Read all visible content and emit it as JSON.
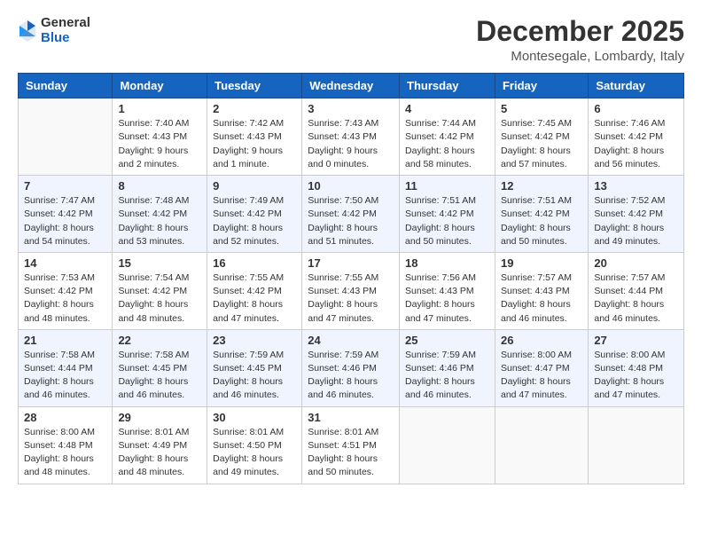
{
  "header": {
    "logo_general": "General",
    "logo_blue": "Blue",
    "month_title": "December 2025",
    "location": "Montesegale, Lombardy, Italy"
  },
  "days_of_week": [
    "Sunday",
    "Monday",
    "Tuesday",
    "Wednesday",
    "Thursday",
    "Friday",
    "Saturday"
  ],
  "weeks": [
    [
      {
        "day": "",
        "info": ""
      },
      {
        "day": "1",
        "info": "Sunrise: 7:40 AM\nSunset: 4:43 PM\nDaylight: 9 hours\nand 2 minutes."
      },
      {
        "day": "2",
        "info": "Sunrise: 7:42 AM\nSunset: 4:43 PM\nDaylight: 9 hours\nand 1 minute."
      },
      {
        "day": "3",
        "info": "Sunrise: 7:43 AM\nSunset: 4:43 PM\nDaylight: 9 hours\nand 0 minutes."
      },
      {
        "day": "4",
        "info": "Sunrise: 7:44 AM\nSunset: 4:42 PM\nDaylight: 8 hours\nand 58 minutes."
      },
      {
        "day": "5",
        "info": "Sunrise: 7:45 AM\nSunset: 4:42 PM\nDaylight: 8 hours\nand 57 minutes."
      },
      {
        "day": "6",
        "info": "Sunrise: 7:46 AM\nSunset: 4:42 PM\nDaylight: 8 hours\nand 56 minutes."
      }
    ],
    [
      {
        "day": "7",
        "info": "Sunrise: 7:47 AM\nSunset: 4:42 PM\nDaylight: 8 hours\nand 54 minutes."
      },
      {
        "day": "8",
        "info": "Sunrise: 7:48 AM\nSunset: 4:42 PM\nDaylight: 8 hours\nand 53 minutes."
      },
      {
        "day": "9",
        "info": "Sunrise: 7:49 AM\nSunset: 4:42 PM\nDaylight: 8 hours\nand 52 minutes."
      },
      {
        "day": "10",
        "info": "Sunrise: 7:50 AM\nSunset: 4:42 PM\nDaylight: 8 hours\nand 51 minutes."
      },
      {
        "day": "11",
        "info": "Sunrise: 7:51 AM\nSunset: 4:42 PM\nDaylight: 8 hours\nand 50 minutes."
      },
      {
        "day": "12",
        "info": "Sunrise: 7:51 AM\nSunset: 4:42 PM\nDaylight: 8 hours\nand 50 minutes."
      },
      {
        "day": "13",
        "info": "Sunrise: 7:52 AM\nSunset: 4:42 PM\nDaylight: 8 hours\nand 49 minutes."
      }
    ],
    [
      {
        "day": "14",
        "info": "Sunrise: 7:53 AM\nSunset: 4:42 PM\nDaylight: 8 hours\nand 48 minutes."
      },
      {
        "day": "15",
        "info": "Sunrise: 7:54 AM\nSunset: 4:42 PM\nDaylight: 8 hours\nand 48 minutes."
      },
      {
        "day": "16",
        "info": "Sunrise: 7:55 AM\nSunset: 4:42 PM\nDaylight: 8 hours\nand 47 minutes."
      },
      {
        "day": "17",
        "info": "Sunrise: 7:55 AM\nSunset: 4:43 PM\nDaylight: 8 hours\nand 47 minutes."
      },
      {
        "day": "18",
        "info": "Sunrise: 7:56 AM\nSunset: 4:43 PM\nDaylight: 8 hours\nand 47 minutes."
      },
      {
        "day": "19",
        "info": "Sunrise: 7:57 AM\nSunset: 4:43 PM\nDaylight: 8 hours\nand 46 minutes."
      },
      {
        "day": "20",
        "info": "Sunrise: 7:57 AM\nSunset: 4:44 PM\nDaylight: 8 hours\nand 46 minutes."
      }
    ],
    [
      {
        "day": "21",
        "info": "Sunrise: 7:58 AM\nSunset: 4:44 PM\nDaylight: 8 hours\nand 46 minutes."
      },
      {
        "day": "22",
        "info": "Sunrise: 7:58 AM\nSunset: 4:45 PM\nDaylight: 8 hours\nand 46 minutes."
      },
      {
        "day": "23",
        "info": "Sunrise: 7:59 AM\nSunset: 4:45 PM\nDaylight: 8 hours\nand 46 minutes."
      },
      {
        "day": "24",
        "info": "Sunrise: 7:59 AM\nSunset: 4:46 PM\nDaylight: 8 hours\nand 46 minutes."
      },
      {
        "day": "25",
        "info": "Sunrise: 7:59 AM\nSunset: 4:46 PM\nDaylight: 8 hours\nand 46 minutes."
      },
      {
        "day": "26",
        "info": "Sunrise: 8:00 AM\nSunset: 4:47 PM\nDaylight: 8 hours\nand 47 minutes."
      },
      {
        "day": "27",
        "info": "Sunrise: 8:00 AM\nSunset: 4:48 PM\nDaylight: 8 hours\nand 47 minutes."
      }
    ],
    [
      {
        "day": "28",
        "info": "Sunrise: 8:00 AM\nSunset: 4:48 PM\nDaylight: 8 hours\nand 48 minutes."
      },
      {
        "day": "29",
        "info": "Sunrise: 8:01 AM\nSunset: 4:49 PM\nDaylight: 8 hours\nand 48 minutes."
      },
      {
        "day": "30",
        "info": "Sunrise: 8:01 AM\nSunset: 4:50 PM\nDaylight: 8 hours\nand 49 minutes."
      },
      {
        "day": "31",
        "info": "Sunrise: 8:01 AM\nSunset: 4:51 PM\nDaylight: 8 hours\nand 50 minutes."
      },
      {
        "day": "",
        "info": ""
      },
      {
        "day": "",
        "info": ""
      },
      {
        "day": "",
        "info": ""
      }
    ]
  ]
}
